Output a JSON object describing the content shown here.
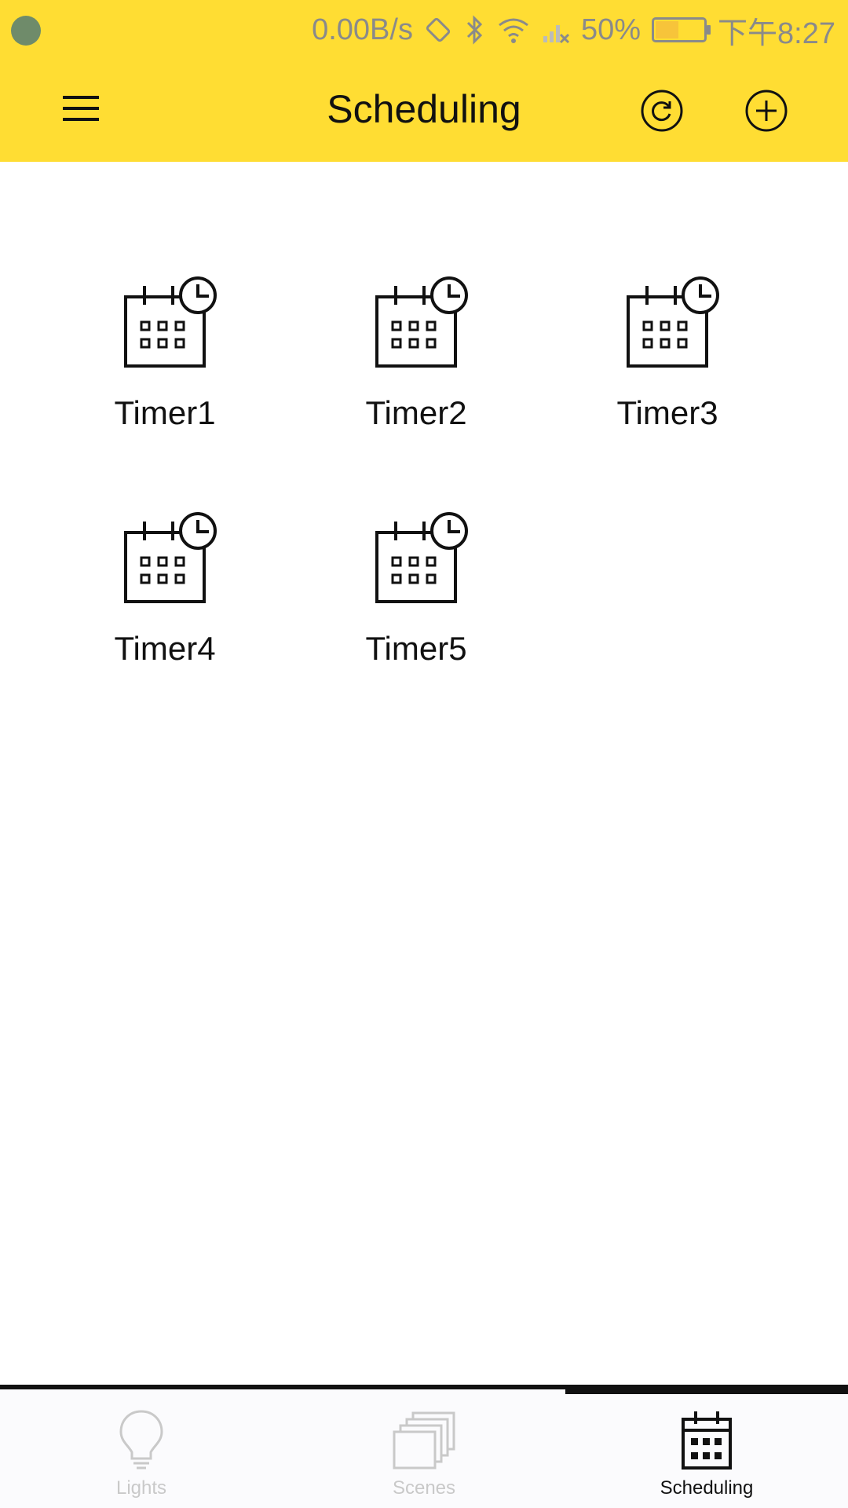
{
  "status_bar": {
    "net_speed": "0.00B/s",
    "battery": "50%",
    "time": "下午8:27",
    "icons": [
      "app-notification-icon",
      "rotate-icon",
      "bluetooth-icon",
      "wifi-icon",
      "signal-icon",
      "battery-icon"
    ]
  },
  "app_bar": {
    "title": "Scheduling",
    "icons": [
      "menu-icon",
      "refresh-icon",
      "add-icon"
    ]
  },
  "timers": [
    {
      "label": "Timer1",
      "icon": "calendar-clock-icon"
    },
    {
      "label": "Timer2",
      "icon": "calendar-clock-icon"
    },
    {
      "label": "Timer3",
      "icon": "calendar-clock-icon"
    },
    {
      "label": "Timer4",
      "icon": "calendar-clock-icon"
    },
    {
      "label": "Timer5",
      "icon": "calendar-clock-icon"
    }
  ],
  "bottom_nav": {
    "items": [
      {
        "label": "Lights",
        "icon": "lightbulb-icon",
        "active": false
      },
      {
        "label": "Scenes",
        "icon": "scenes-stack-icon",
        "active": false
      },
      {
        "label": "Scheduling",
        "icon": "calendar-icon",
        "active": true
      }
    ]
  },
  "colors": {
    "accent": "#FFDD33",
    "text": "#111111",
    "inactive": "#C9C9C9"
  }
}
